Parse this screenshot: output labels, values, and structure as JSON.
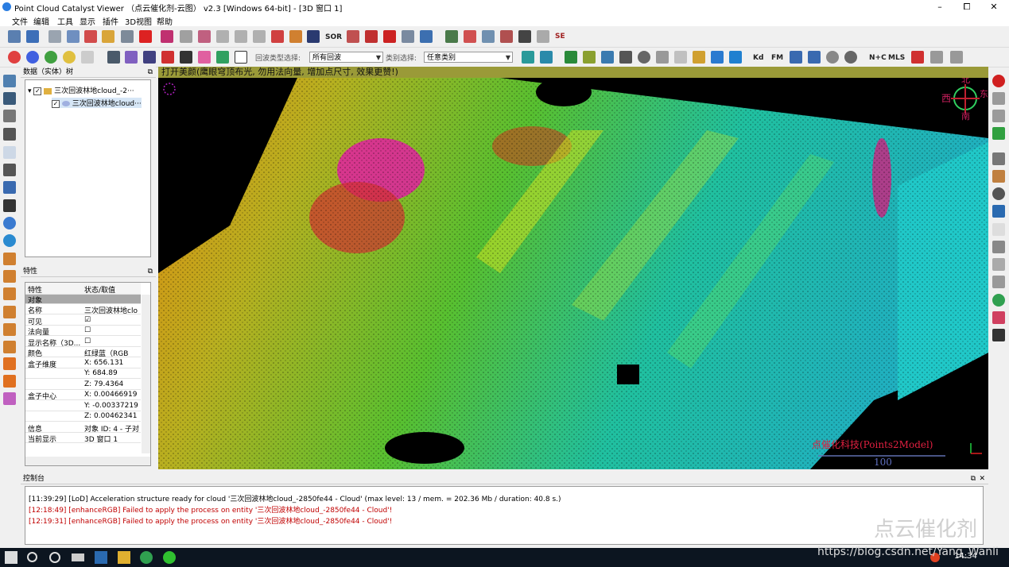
{
  "window": {
    "title": "Point Cloud Catalyst Viewer （点云催化剂-云图） v2.3 [Windows 64-bit] - [3D 窗口 1]",
    "minimize": "–",
    "maximize": "⧠",
    "close": "✕"
  },
  "menu": [
    "文件",
    "编辑",
    "工具",
    "显示",
    "插件",
    "3D视图",
    "帮助"
  ],
  "toolbar2": {
    "echo_type_label": "回波类型选择:",
    "echo_type_value": "所有回波",
    "class_label": "类别选择:",
    "class_value": "任意类别"
  },
  "toolbar_icons": {
    "sor_label": "SOR",
    "se_label": "SE",
    "kd_label": "Kd",
    "fm_label": "FM",
    "nc_label": "N+C",
    "mls_label": "MLS"
  },
  "db_tree": {
    "title": "数据（实体）树",
    "root": "三次回波林地cloud_-2···",
    "child": "三次回波林地cloud···"
  },
  "properties": {
    "title": "特性",
    "header_key": "特性",
    "header_val": "状态/取值",
    "section": "对象",
    "rows": [
      {
        "k": "名称",
        "v": "三次回波林地clo"
      },
      {
        "k": "可见",
        "v": "☑"
      },
      {
        "k": "法向量",
        "v": "☐"
      },
      {
        "k": "显示名称（3D...",
        "v": "☐"
      },
      {
        "k": "颜色",
        "v": "红绿蓝（RGB"
      },
      {
        "k": "盒子维度",
        "v": "X: 656.131"
      },
      {
        "k": "",
        "v": "Y: 684.89"
      },
      {
        "k": "",
        "v": "Z: 79.4364"
      },
      {
        "k": "盒子中心",
        "v": "X: 0.00466919"
      },
      {
        "k": "",
        "v": "Y: -0.00337219"
      },
      {
        "k": "",
        "v": "Z: 0.00462341"
      },
      {
        "k": "信息",
        "v": "对象 ID: 4 - 子对"
      },
      {
        "k": "当前显示",
        "v": "3D 窗口 1"
      }
    ]
  },
  "viewport": {
    "hint": "打开美颜(鹰眼穹顶布光, 勿用法向量, 增加点尺寸, 效果更赞!)",
    "compass_west": "西",
    "compass_north": "北",
    "compass_east": "东",
    "compass_south": "南",
    "brand": "点催化科技(Points2Model)",
    "scale_value": "100"
  },
  "console": {
    "title": "控制台",
    "lines": [
      {
        "text": "[11:39:29] [LoD] Acceleration structure ready for cloud '三次回波林地cloud_-2850fe44 - Cloud' (max level: 13 / mem. = 202.36 Mb / duration: 40.8 s.)",
        "color": "#222222"
      },
      {
        "text": "[12:18:49] [enhanceRGB] Failed to apply the process on entity '三次回波林地cloud_-2850fe44 - Cloud'!",
        "color": "#c00000"
      },
      {
        "text": "[12:19:31] [enhanceRGB] Failed to apply the process on entity '三次回波林地cloud_-2850fe44 - Cloud'!",
        "color": "#c00000"
      }
    ]
  },
  "watermarks": {
    "wechat": "点云催化剂",
    "url": "https://blog.csdn.net/Yang_Wanli"
  },
  "taskbar": {
    "time": "14:34"
  }
}
